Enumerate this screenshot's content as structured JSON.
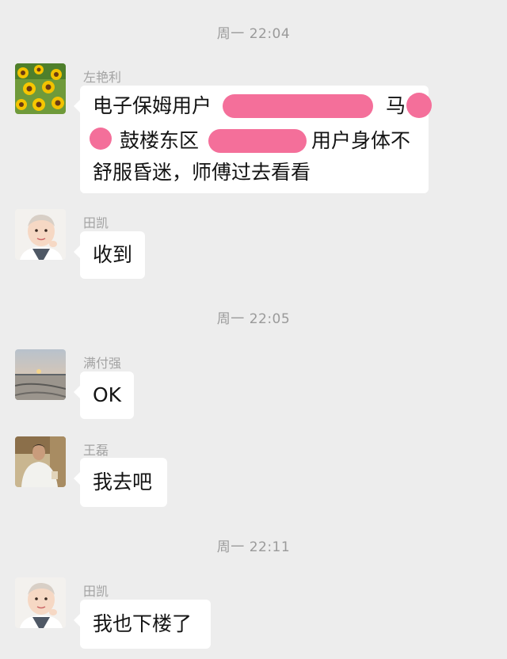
{
  "timestamps": [
    "周一 22:04",
    "周一 22:05",
    "周一 22:11"
  ],
  "messages": [
    {
      "sender": "左艳利",
      "avatar": "sunflower-avatar-icon",
      "lines": [
        [
          "电子保姆用户",
          "马"
        ],
        [
          "鼓楼东区",
          "用户身体不"
        ],
        [
          "舒服昏迷，师傅过去看看"
        ]
      ]
    },
    {
      "sender": "田凯",
      "avatar": "child-avatar-icon",
      "text": "收到"
    },
    {
      "sender": "满付强",
      "avatar": "sunset-lake-avatar-icon",
      "text": "OK"
    },
    {
      "sender": "王磊",
      "avatar": "man-photo-avatar-icon",
      "text": "我去吧"
    },
    {
      "sender": "田凯",
      "avatar": "child-avatar-icon",
      "text": "我也下楼了"
    }
  ],
  "colors": {
    "background": "#ededed",
    "bubble": "#ffffff",
    "redaction": "#f46f9a",
    "timestamp": "#9a9a9a",
    "sender_name": "#a3a3a3"
  }
}
